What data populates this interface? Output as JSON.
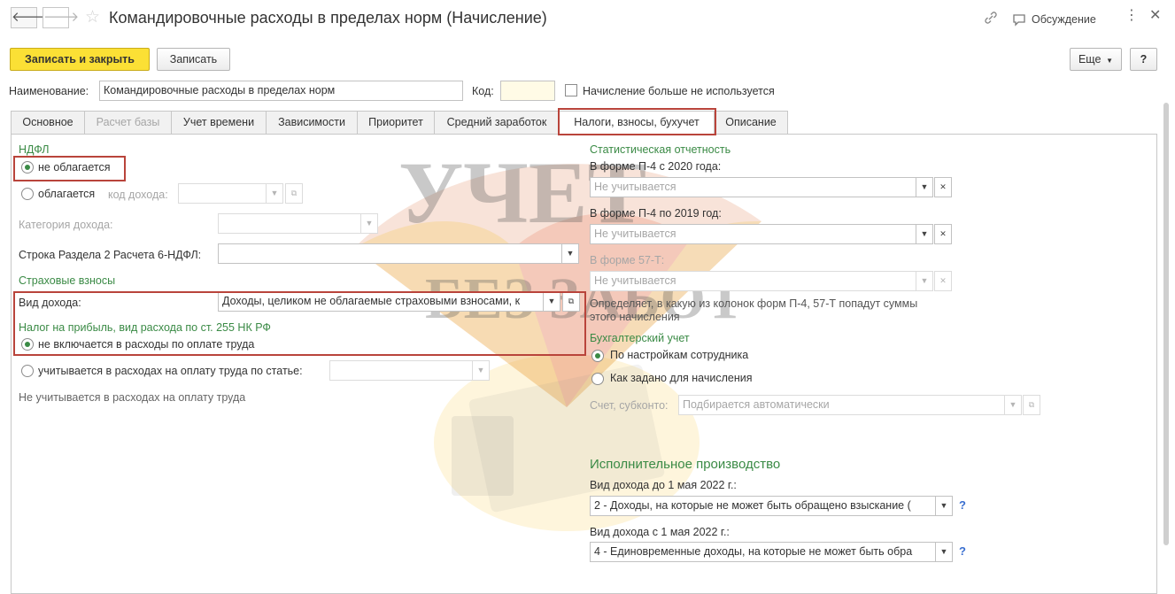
{
  "titlebar": {
    "title": "Командировочные расходы в пределах норм (Начисление)",
    "back_icon": "arrow-left-icon",
    "forward_icon": "arrow-right-icon",
    "favorite_icon": "star-icon",
    "link_icon": "link-icon",
    "discussion_label": "Обсуждение",
    "more_icon": "more-vertical-icon",
    "close_icon": "close-icon"
  },
  "toolbar": {
    "save_close_label": "Записать и закрыть",
    "save_label": "Записать",
    "more_label": "Еще",
    "help_label": "?"
  },
  "form": {
    "name_label": "Наименование:",
    "name_value": "Командировочные расходы в пределах норм",
    "code_label": "Код:",
    "code_value": "",
    "not_used_label": "Начисление больше не используется",
    "not_used_checked": false
  },
  "tabs": [
    {
      "label": "Основное",
      "enabled": true,
      "active": false
    },
    {
      "label": "Расчет базы",
      "enabled": false,
      "active": false
    },
    {
      "label": "Учет времени",
      "enabled": true,
      "active": false
    },
    {
      "label": "Зависимости",
      "enabled": true,
      "active": false
    },
    {
      "label": "Приоритет",
      "enabled": true,
      "active": false
    },
    {
      "label": "Средний заработок",
      "enabled": true,
      "active": false
    },
    {
      "label": "Налоги, взносы, бухучет",
      "enabled": true,
      "active": true
    },
    {
      "label": "Описание",
      "enabled": true,
      "active": false
    }
  ],
  "ndfl": {
    "heading": "НДФЛ",
    "not_taxed_label": "не облагается",
    "taxed_label": "облагается",
    "income_code_label": "код дохода:",
    "income_code_value": "",
    "income_category_label": "Категория дохода:",
    "income_category_value": "",
    "row_6ndfl_label": "Строка Раздела 2 Расчета 6-НДФЛ:",
    "row_6ndfl_value": "",
    "selected": "not_taxed"
  },
  "insurance": {
    "heading": "Страховые взносы",
    "income_type_label": "Вид дохода:",
    "income_type_value": "Доходы, целиком не облагаемые страховыми взносами, к"
  },
  "profit_tax": {
    "heading": "Налог на прибыль, вид расхода по ст. 255 НК РФ",
    "not_included_label": "не включается в расходы по оплате труда",
    "included_label": "учитывается в расходах на оплату труда по статье:",
    "article_value": "",
    "note": "Не учитывается в расходах на оплату труда",
    "selected": "not_included"
  },
  "statistics": {
    "heading": "Статистическая отчетность",
    "p4_2020_label": "В форме П-4 с 2020 года:",
    "p4_2020_value": "Не учитывается",
    "p4_2019_label": "В форме П-4 по 2019 год:",
    "p4_2019_value": "Не учитывается",
    "f57t_label": "В форме 57-Т:",
    "f57t_value": "Не учитывается",
    "note_line1": "Определяет, в какую из колонок форм П-4, 57-Т попадут суммы",
    "note_line2": "этого начисления"
  },
  "accounting": {
    "heading": "Бухгалтерский учет",
    "by_employee_label": "По настройкам сотрудника",
    "as_accrual_label": "Как задано для начисления",
    "account_label": "Счет, субконто:",
    "account_value": "Подбирается автоматически",
    "selected": "by_employee"
  },
  "enforcement": {
    "heading": "Исполнительное производство",
    "before_label": "Вид дохода до 1 мая 2022 г.:",
    "before_value": "2 - Доходы, на которые не может быть обращено взыскание (",
    "after_label": "Вид дохода с 1 мая 2022 г.:",
    "after_value": "4 - Единовременные доходы, на которые не может быть обра",
    "help": "?"
  },
  "watermark": {
    "line1": "УЧЕТ",
    "line2": "БЕЗ ЗАБОТ"
  },
  "colors": {
    "accent_green": "#3a8a45",
    "primary_yellow": "#fbe035",
    "highlight_red": "#b9443b"
  }
}
